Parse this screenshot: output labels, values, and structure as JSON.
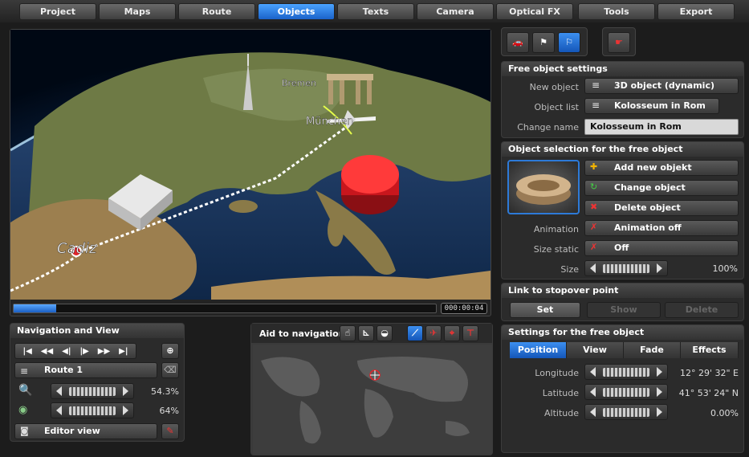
{
  "tabs": [
    "Project",
    "Maps",
    "Route",
    "Objects",
    "Texts",
    "Camera",
    "Optical FX",
    "Tools",
    "Export"
  ],
  "active_tab": "Objects",
  "map": {
    "labels": [
      "Bremen",
      "München",
      "Cadiz"
    ],
    "timecode": "000:00:04",
    "progress_fraction": 0.1
  },
  "navigation": {
    "title": "Navigation and View",
    "route": "Route 1",
    "zoom_value": "54.3%",
    "speed_value": "64%",
    "view_mode": "Editor view"
  },
  "aid": {
    "title": "Aid to navigation"
  },
  "free_object_settings": {
    "title": "Free object settings",
    "new_object_label": "New object",
    "new_object_value": "3D object (dynamic)",
    "object_list_label": "Object list",
    "object_list_value": "Kolosseum in Rom",
    "change_name_label": "Change name",
    "change_name_value": "Kolosseum in Rom"
  },
  "object_selection": {
    "title": "Object selection for the free object",
    "add": "Add new objekt",
    "change": "Change object",
    "delete": "Delete object",
    "animation_label": "Animation",
    "animation_value": "Animation off",
    "size_static_label": "Size static",
    "size_static_value": "Off",
    "size_label": "Size",
    "size_value": "100%"
  },
  "stopover": {
    "title": "Link to stopover point",
    "set": "Set",
    "show": "Show",
    "delete": "Delete"
  },
  "settings": {
    "title": "Settings for the free object",
    "tabs": [
      "Position",
      "View",
      "Fade",
      "Effects"
    ],
    "active_tab": "Position",
    "longitude_label": "Longitude",
    "longitude_value": "12° 29' 32\" E",
    "latitude_label": "Latitude",
    "latitude_value": "41° 53' 24\" N",
    "altitude_label": "Altitude",
    "altitude_value": "0.00%"
  },
  "colors": {
    "accent": "#1f6fd6",
    "marker": "#e0242a"
  }
}
